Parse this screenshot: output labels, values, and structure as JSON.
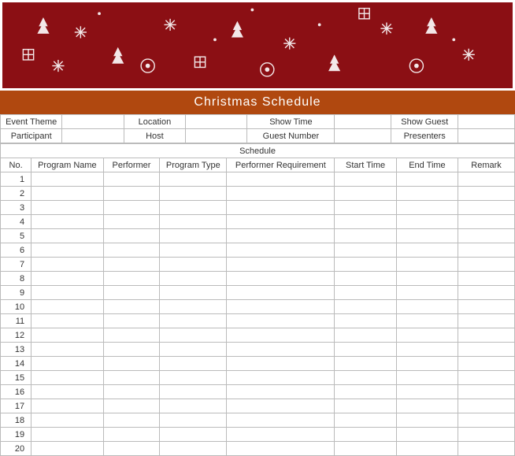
{
  "title": "Christmas  Schedule",
  "meta": {
    "row1": {
      "c1_label": "Event Theme",
      "c1_value": "",
      "c2_label": "Location",
      "c2_value": "",
      "c3_label": "Show Time",
      "c3_value": "",
      "c4_label": "Show Guest",
      "c4_value": ""
    },
    "row2": {
      "c1_label": "Participant",
      "c1_value": "",
      "c2_label": "Host",
      "c2_value": "",
      "c3_label": "Guest Number",
      "c3_value": "",
      "c4_label": "Presenters",
      "c4_value": ""
    }
  },
  "schedule_label": "Schedule",
  "columns": {
    "no": "No.",
    "program_name": "Program Name",
    "performer": "Performer",
    "program_type": "Program Type",
    "performer_requirement": "Performer Requirement",
    "start_time": "Start Time",
    "end_time": "End Time",
    "remark": "Remark"
  },
  "rows": [
    {
      "no": "1",
      "program_name": "",
      "performer": "",
      "program_type": "",
      "performer_requirement": "",
      "start_time": "",
      "end_time": "",
      "remark": ""
    },
    {
      "no": "2",
      "program_name": "",
      "performer": "",
      "program_type": "",
      "performer_requirement": "",
      "start_time": "",
      "end_time": "",
      "remark": ""
    },
    {
      "no": "3",
      "program_name": "",
      "performer": "",
      "program_type": "",
      "performer_requirement": "",
      "start_time": "",
      "end_time": "",
      "remark": ""
    },
    {
      "no": "4",
      "program_name": "",
      "performer": "",
      "program_type": "",
      "performer_requirement": "",
      "start_time": "",
      "end_time": "",
      "remark": ""
    },
    {
      "no": "5",
      "program_name": "",
      "performer": "",
      "program_type": "",
      "performer_requirement": "",
      "start_time": "",
      "end_time": "",
      "remark": ""
    },
    {
      "no": "6",
      "program_name": "",
      "performer": "",
      "program_type": "",
      "performer_requirement": "",
      "start_time": "",
      "end_time": "",
      "remark": ""
    },
    {
      "no": "7",
      "program_name": "",
      "performer": "",
      "program_type": "",
      "performer_requirement": "",
      "start_time": "",
      "end_time": "",
      "remark": ""
    },
    {
      "no": "8",
      "program_name": "",
      "performer": "",
      "program_type": "",
      "performer_requirement": "",
      "start_time": "",
      "end_time": "",
      "remark": ""
    },
    {
      "no": "9",
      "program_name": "",
      "performer": "",
      "program_type": "",
      "performer_requirement": "",
      "start_time": "",
      "end_time": "",
      "remark": ""
    },
    {
      "no": "10",
      "program_name": "",
      "performer": "",
      "program_type": "",
      "performer_requirement": "",
      "start_time": "",
      "end_time": "",
      "remark": ""
    },
    {
      "no": "11",
      "program_name": "",
      "performer": "",
      "program_type": "",
      "performer_requirement": "",
      "start_time": "",
      "end_time": "",
      "remark": ""
    },
    {
      "no": "12",
      "program_name": "",
      "performer": "",
      "program_type": "",
      "performer_requirement": "",
      "start_time": "",
      "end_time": "",
      "remark": ""
    },
    {
      "no": "13",
      "program_name": "",
      "performer": "",
      "program_type": "",
      "performer_requirement": "",
      "start_time": "",
      "end_time": "",
      "remark": ""
    },
    {
      "no": "14",
      "program_name": "",
      "performer": "",
      "program_type": "",
      "performer_requirement": "",
      "start_time": "",
      "end_time": "",
      "remark": ""
    },
    {
      "no": "15",
      "program_name": "",
      "performer": "",
      "program_type": "",
      "performer_requirement": "",
      "start_time": "",
      "end_time": "",
      "remark": ""
    },
    {
      "no": "16",
      "program_name": "",
      "performer": "",
      "program_type": "",
      "performer_requirement": "",
      "start_time": "",
      "end_time": "",
      "remark": ""
    },
    {
      "no": "17",
      "program_name": "",
      "performer": "",
      "program_type": "",
      "performer_requirement": "",
      "start_time": "",
      "end_time": "",
      "remark": ""
    },
    {
      "no": "18",
      "program_name": "",
      "performer": "",
      "program_type": "",
      "performer_requirement": "",
      "start_time": "",
      "end_time": "",
      "remark": ""
    },
    {
      "no": "19",
      "program_name": "",
      "performer": "",
      "program_type": "",
      "performer_requirement": "",
      "start_time": "",
      "end_time": "",
      "remark": ""
    },
    {
      "no": "20",
      "program_name": "",
      "performer": "",
      "program_type": "",
      "performer_requirement": "",
      "start_time": "",
      "end_time": "",
      "remark": ""
    }
  ]
}
